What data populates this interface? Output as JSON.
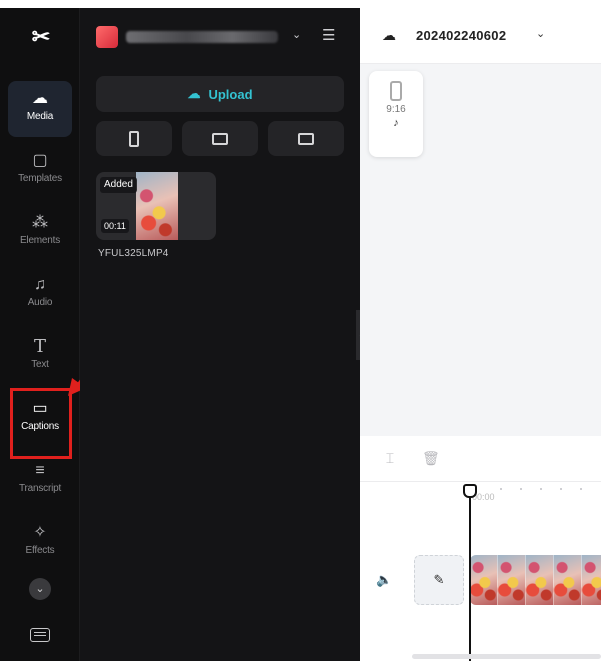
{
  "sidebar": {
    "items": [
      {
        "label": "Media",
        "icon": "media-cloud-icon"
      },
      {
        "label": "Templates",
        "icon": "templates-icon"
      },
      {
        "label": "Elements",
        "icon": "elements-icon"
      },
      {
        "label": "Audio",
        "icon": "audio-note-icon"
      },
      {
        "label": "Text",
        "icon": "text-t-icon"
      },
      {
        "label": "Captions",
        "icon": "captions-icon"
      },
      {
        "label": "Transcript",
        "icon": "transcript-icon"
      },
      {
        "label": "Effects",
        "icon": "effects-sparkle-icon"
      }
    ]
  },
  "panel": {
    "upload_label": "Upload",
    "media": [
      {
        "badge": "Added",
        "duration": "00:11",
        "name": "YFUL325LMP4"
      }
    ]
  },
  "header": {
    "project_title": "202402240602"
  },
  "canvas": {
    "ratio": "9:16"
  },
  "timeline": {
    "time_label": "00:00"
  },
  "colors": {
    "accent": "#34c2d1",
    "highlight": "#e0201d",
    "sidebar_bg": "#0f0f10",
    "panel_bg": "#141416"
  }
}
